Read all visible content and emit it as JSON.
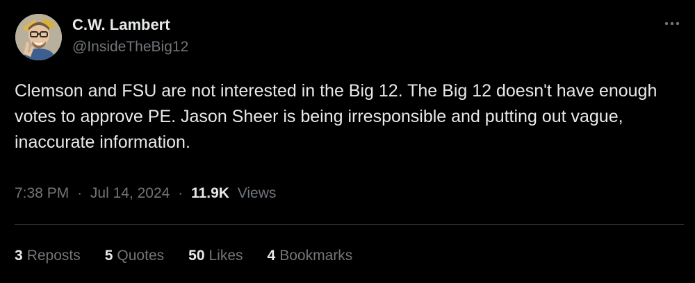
{
  "author": {
    "display_name": "C.W. Lambert",
    "handle": "@InsideTheBig12",
    "avatar_icon": "memoji-avatar-icon"
  },
  "menu": {
    "icon": "more-horizontal-icon",
    "glyph": "···"
  },
  "tweet": {
    "text": "Clemson and FSU are not interested in the Big 12. The Big 12 doesn't have enough votes to approve PE. Jason Sheer is being irresponsible and putting out vague, inaccurate information."
  },
  "meta": {
    "time": "7:38 PM",
    "separator": "·",
    "date": "Jul 14, 2024",
    "views_count": "11.9K",
    "views_label": "Views"
  },
  "stats": {
    "reposts": {
      "count": "3",
      "label": "Reposts"
    },
    "quotes": {
      "count": "5",
      "label": "Quotes"
    },
    "likes": {
      "count": "50",
      "label": "Likes"
    },
    "bookmarks": {
      "count": "4",
      "label": "Bookmarks"
    }
  },
  "colors": {
    "background": "#000000",
    "primary_text": "#e7e9ea",
    "secondary_text": "#71767b",
    "divider": "#2f3336"
  }
}
